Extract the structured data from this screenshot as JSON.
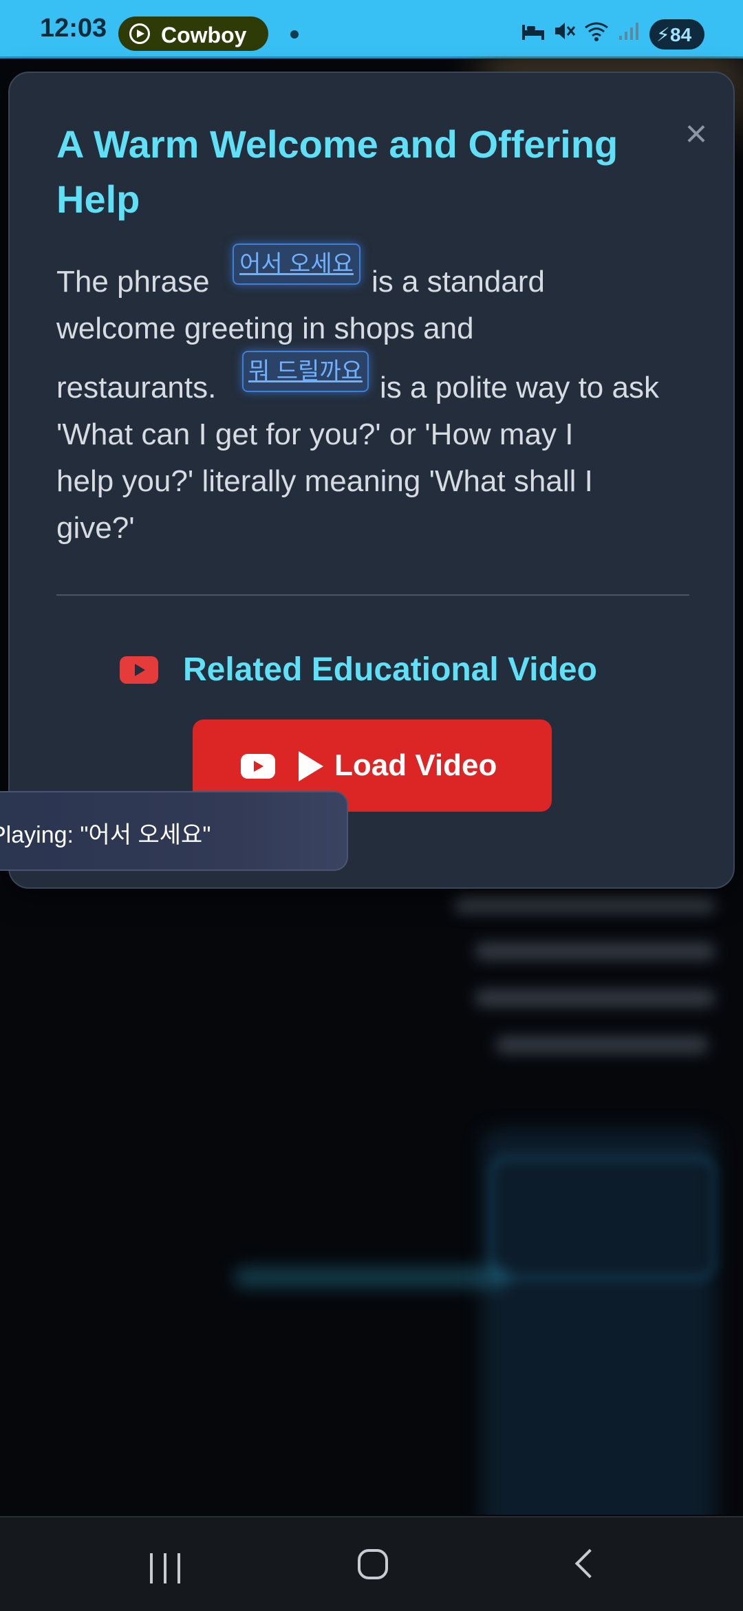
{
  "status_bar": {
    "time": "12:03",
    "app_pill_label": "Cowboy",
    "battery_level": "84",
    "icons": [
      "alarm-icon",
      "mute-icon",
      "wifi-icon",
      "signal-icon",
      "battery-icon"
    ]
  },
  "modal": {
    "title": "A Warm Welcome and Offering Help",
    "close_glyph": "×",
    "body": {
      "l1_pre": "The phrase",
      "chip1": "어서 오세요",
      "l1_post": "is a standard",
      "l2": "welcome greeting in shops and",
      "l3_pre": "restaurants.",
      "chip2": "뭐 드릴까요",
      "l3_post": "is a polite way to ask",
      "l4": "'What can I get for you?' or 'How may I",
      "l5": "help you?' literally meaning 'What shall I",
      "l6": "give?'"
    },
    "related_title": "Related Educational Video",
    "load_button_label": "Load Video"
  },
  "toast": {
    "text": "Playing: \"어서 오세요\""
  },
  "colors": {
    "accent": "#5fe0f6",
    "button_red": "#dc2626",
    "modal_bg": "#232d3b",
    "status_bar": "#38c0f5"
  }
}
